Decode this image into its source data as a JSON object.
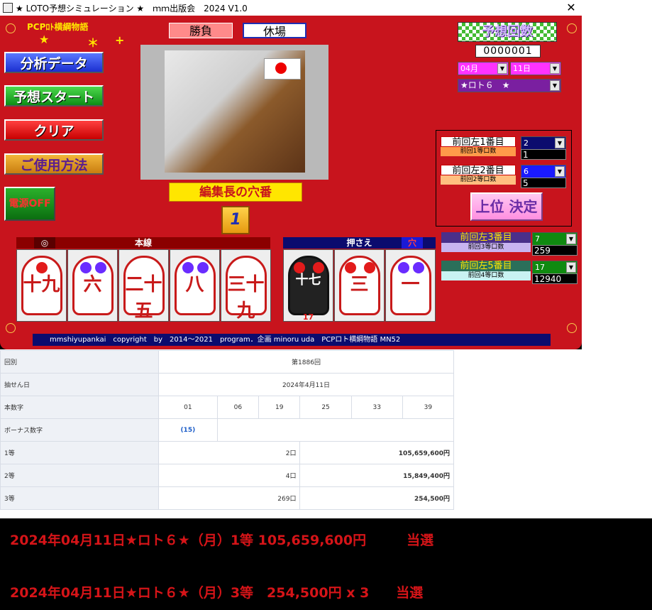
{
  "window": {
    "title": "★ LOTO予想シミュレーション ★　ｍｍ出版会　2024 V1.0",
    "close_glyph": "✕"
  },
  "brand": {
    "name": "PCPﾛﾄ横綱物語",
    "stars": [
      "★",
      "＊",
      "+"
    ]
  },
  "left_buttons": {
    "analysis": "分析データ",
    "start": "予想スタート",
    "clear": "クリア",
    "usage": "ご使用方法",
    "power": "電源OFF"
  },
  "tabs": {
    "win": "勝負",
    "rest": "休場"
  },
  "photo": {
    "caption": "編集長の穴番",
    "number": "1"
  },
  "counter": {
    "label": "予想回数",
    "value": "0000001"
  },
  "date": {
    "month": "04月",
    "day": "11日"
  },
  "game_select": "★ロト６　★",
  "prev": [
    {
      "title": "前回左1番目",
      "sub": "前回1等口数",
      "select": "2",
      "value": "1"
    },
    {
      "title": "前回左2番目",
      "sub": "前回2等口数",
      "select": "6",
      "value": "5"
    },
    {
      "title": "前回左3番目",
      "sub": "前回3等口数",
      "select": "7",
      "value": "259"
    },
    {
      "title": "前回左5番目",
      "sub": "前回4等口数",
      "select": "17",
      "value": "12940"
    }
  ],
  "decide_button": "上位 決定",
  "main_line": {
    "label": "本線",
    "mark": "◎",
    "tiles": [
      "十九",
      "六",
      "二十五",
      "八",
      "三十九"
    ]
  },
  "hold_line": {
    "label": "押さえ",
    "mark": "穴",
    "tiles": [
      "十七",
      "三",
      "一"
    ],
    "badge": "17"
  },
  "footer": "mmshiyupankai　copyright　by　2014～2021　program．企画 minoru uda　PCPロト横綱物語 MN52",
  "results": {
    "round_label": "回別",
    "round": "第1886回",
    "date_label": "抽せん日",
    "date": "2024年4月11日",
    "main_label": "本数字",
    "main": [
      "01",
      "06",
      "19",
      "25",
      "33",
      "39"
    ],
    "bonus_label": "ボーナス数字",
    "bonus": "(15)",
    "prizes": [
      {
        "rank": "1等",
        "count": "2口",
        "amount": "105,659,600円"
      },
      {
        "rank": "2等",
        "count": "4口",
        "amount": "15,849,400円"
      },
      {
        "rank": "3等",
        "count": "269口",
        "amount": "254,500円"
      }
    ]
  },
  "announcements": [
    "2024年04月11日★ロト６★（月）1等 105,659,600円　　　当選",
    "2024年04月11日★ロト６★（月）3等　254,500円 x 3　　当選"
  ],
  "colors": {
    "panel": "#c8141d",
    "accent_yellow": "#ffe600",
    "result_red": "#d51418"
  }
}
